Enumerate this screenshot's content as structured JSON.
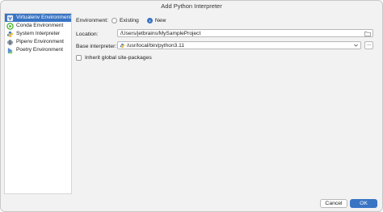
{
  "window": {
    "title": "Add Python Interpreter"
  },
  "sidebar": {
    "items": [
      {
        "label": "Virtualenv Environment",
        "icon": "virtualenv-icon",
        "active": true
      },
      {
        "label": "Conda Environment",
        "icon": "conda-icon",
        "active": false
      },
      {
        "label": "System Interpreter",
        "icon": "python-icon",
        "active": false
      },
      {
        "label": "Pipenv Environment",
        "icon": "pipenv-icon",
        "active": false
      },
      {
        "label": "Poetry Environment",
        "icon": "poetry-icon",
        "active": false
      }
    ]
  },
  "form": {
    "environment_label": "Environment:",
    "environment_options": [
      "Existing",
      "New"
    ],
    "environment_selected": "New",
    "location_label": "Location:",
    "location_value": "/Users/jetbrains/MySampleProject",
    "base_interpreter_label": "Base interpreter:",
    "base_interpreter_value": "/usr/local/bin/python3.11",
    "browse_label": "...",
    "inherit_label": "Inherit global site-packages",
    "inherit_checked": false
  },
  "footer": {
    "cancel_label": "Cancel",
    "ok_label": "OK"
  },
  "colors": {
    "accent": "#3a75c4",
    "python_yellow": "#f6c343",
    "python_blue": "#4a7fb5"
  }
}
